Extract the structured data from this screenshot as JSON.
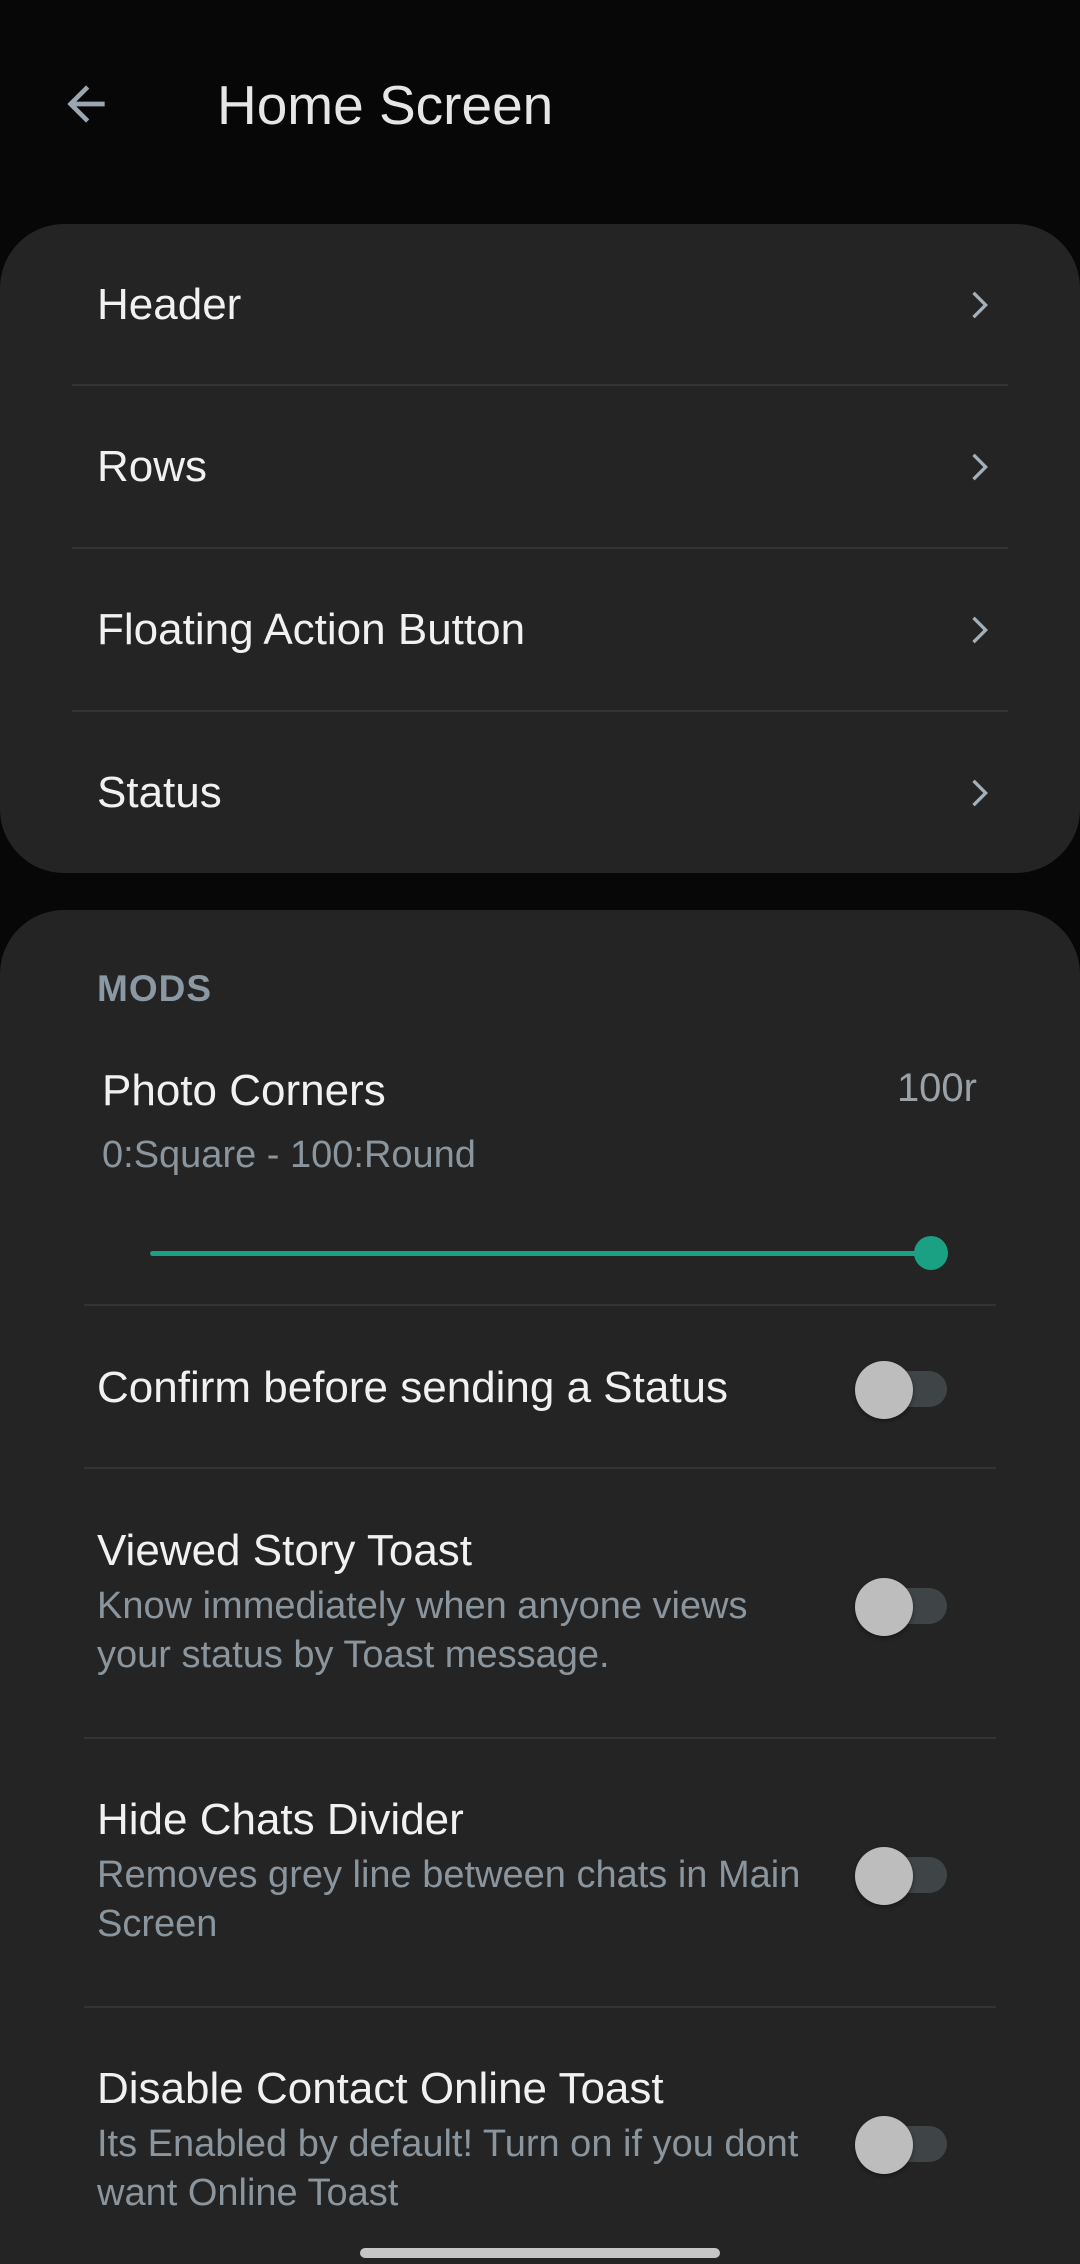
{
  "header": {
    "title": "Home Screen",
    "back_icon": "arrow-left-icon"
  },
  "nav_items": [
    {
      "label": "Header",
      "icon": "chevron-right-icon"
    },
    {
      "label": "Rows",
      "icon": "chevron-right-icon"
    },
    {
      "label": "Floating Action Button",
      "icon": "chevron-right-icon"
    },
    {
      "label": "Status",
      "icon": "chevron-right-icon"
    }
  ],
  "mods": {
    "section_title": "MODS",
    "photo_corners": {
      "title": "Photo Corners",
      "summary": "0:Square - 100:Round",
      "value_label": "100r",
      "value": 100,
      "min": 0,
      "max": 100
    },
    "toggles": [
      {
        "title": "Confirm before sending a Status",
        "summary": "",
        "checked": false
      },
      {
        "title": "Viewed Story Toast",
        "summary": "Know immediately when anyone views your status by Toast message.",
        "checked": false
      },
      {
        "title": "Hide Chats Divider",
        "summary": "Removes grey line between chats in Main Screen",
        "checked": false
      },
      {
        "title": "Disable Contact Online Toast",
        "summary": "Its Enabled by default! Turn on if you dont want Online Toast",
        "checked": false
      }
    ]
  },
  "colors": {
    "accent": "#1aa082",
    "card_bg": "#242424",
    "page_bg": "#070707",
    "secondary_text": "#8a959d"
  }
}
